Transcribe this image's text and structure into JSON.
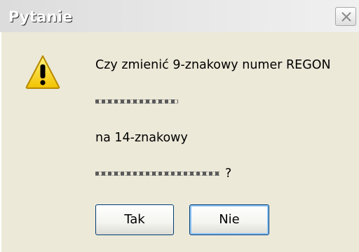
{
  "window": {
    "title": "Pytanie",
    "close_icon": "close-icon"
  },
  "message": {
    "icon": "warning-icon",
    "line1": "Czy zmienić 9-znakowy numer REGON",
    "line3": "na 14-znakowy",
    "line4_suffix": "?"
  },
  "buttons": {
    "yes_label": "Tak",
    "no_label": "Nie"
  },
  "colors": {
    "dialog_bg": "#ece9d8",
    "title_text": "#ffffff",
    "button_border": "#003c74",
    "focus_ring": "#8ec3f7",
    "warning_yellow": "#f7d630"
  }
}
